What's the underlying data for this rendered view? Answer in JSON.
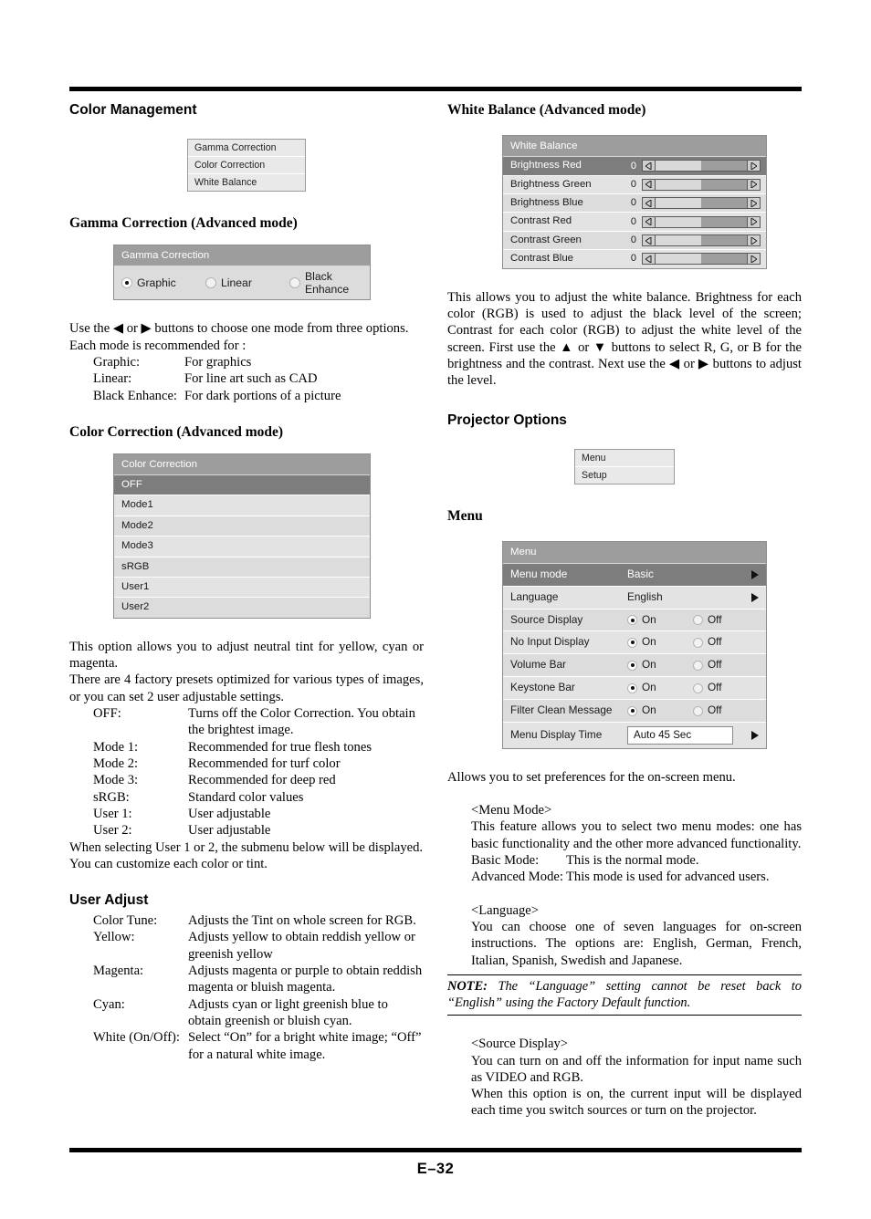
{
  "footer": {
    "page_label": "E–32"
  },
  "left": {
    "heading_color_management": "Color Management",
    "color_management_menu": [
      "Gamma Correction",
      "Color Correction",
      "White Balance"
    ],
    "heading_gamma": "Gamma Correction (Advanced mode)",
    "gamma_panel": {
      "title": "Gamma Correction",
      "options": [
        {
          "label": "Graphic",
          "selected": true
        },
        {
          "label": "Linear",
          "selected": false
        },
        {
          "label": "Black Enhance",
          "selected": false
        }
      ]
    },
    "gamma_text": {
      "line1": "Use the ◀ or ▶ buttons to choose one mode from three options.",
      "line2": "Each mode is recommended for :",
      "items": [
        {
          "term": "Graphic:",
          "desc": "For graphics"
        },
        {
          "term": "Linear:",
          "desc": "For line art such as CAD"
        },
        {
          "term": "Black Enhance:",
          "desc": "For dark portions of a picture"
        }
      ]
    },
    "heading_color_correction": "Color Correction (Advanced mode)",
    "color_correction_panel": {
      "title": "Color Correction",
      "rows": [
        {
          "label": "OFF",
          "selected": true
        },
        {
          "label": "Mode1",
          "selected": false
        },
        {
          "label": "Mode2",
          "selected": false
        },
        {
          "label": "Mode3",
          "selected": false
        },
        {
          "label": "sRGB",
          "selected": false
        },
        {
          "label": "User1",
          "selected": false
        },
        {
          "label": "User2",
          "selected": false
        }
      ]
    },
    "color_correction_text": {
      "para1": "This option allows you to adjust neutral tint for yellow, cyan or magenta.",
      "para2": "There are 4 factory presets optimized for various types of images, or you can set 2 user adjustable settings.",
      "items": [
        {
          "term": "OFF:",
          "desc": "Turns off the Color Correction. You obtain the brightest image."
        },
        {
          "term": "Mode 1:",
          "desc": "Recommended for true flesh tones"
        },
        {
          "term": "Mode 2:",
          "desc": "Recommended for turf color"
        },
        {
          "term": "Mode 3:",
          "desc": "Recommended for deep red"
        },
        {
          "term": "sRGB:",
          "desc": "Standard color values"
        },
        {
          "term": "User 1:",
          "desc": "User adjustable"
        },
        {
          "term": "User 2:",
          "desc": "User adjustable"
        }
      ],
      "para3": "When selecting User 1 or 2, the submenu below will be displayed. You can customize each color or tint."
    },
    "heading_user_adjust": "User Adjust",
    "user_adjust_items": [
      {
        "term": "Color Tune:",
        "desc": "Adjusts the Tint on whole screen for RGB."
      },
      {
        "term": "Yellow:",
        "desc": "Adjusts yellow to obtain reddish yellow or greenish yellow"
      },
      {
        "term": "Magenta:",
        "desc": "Adjusts magenta or purple to obtain reddish magenta or bluish magenta."
      },
      {
        "term": "Cyan:",
        "desc": "Adjusts cyan or light greenish blue to obtain greenish or bluish cyan."
      },
      {
        "term": "White (On/Off):",
        "desc": "Select “On” for a bright white image; “Off” for a natural white image."
      }
    ]
  },
  "right": {
    "heading_white_balance": "White Balance (Advanced mode)",
    "white_balance_panel": {
      "title": "White Balance",
      "rows": [
        {
          "label": "Brightness Red",
          "value": "0",
          "selected": true
        },
        {
          "label": "Brightness Green",
          "value": "0",
          "selected": false
        },
        {
          "label": "Brightness Blue",
          "value": "0",
          "selected": false
        },
        {
          "label": "Contrast Red",
          "value": "0",
          "selected": false
        },
        {
          "label": "Contrast Green",
          "value": "0",
          "selected": false
        },
        {
          "label": "Contrast Blue",
          "value": "0",
          "selected": false
        }
      ]
    },
    "white_balance_text": "This allows you to adjust the white balance. Brightness for each color (RGB) is used to adjust the black level of the screen; Contrast for each color (RGB) to adjust the white level of the screen. First use the ▲ or ▼ buttons to select R, G, or B for the brightness and the contrast. Next use the ◀ or ▶ buttons to adjust the level.",
    "heading_projector_options": "Projector Options",
    "projector_options_menu": [
      "Menu",
      "Setup"
    ],
    "heading_menu": "Menu",
    "menu_panel": {
      "title": "Menu",
      "rows": [
        {
          "label": "Menu mode",
          "type": "value-arrow",
          "value": "Basic",
          "selected": true
        },
        {
          "label": "Language",
          "type": "value-arrow",
          "value": "English",
          "selected": false
        },
        {
          "label": "Source Display",
          "type": "onoff",
          "on_label": "On",
          "off_label": "Off",
          "state": "On",
          "selected": false
        },
        {
          "label": "No Input Display",
          "type": "onoff",
          "on_label": "On",
          "off_label": "Off",
          "state": "On",
          "selected": false
        },
        {
          "label": "Volume Bar",
          "type": "onoff",
          "on_label": "On",
          "off_label": "Off",
          "state": "On",
          "selected": false
        },
        {
          "label": "Keystone Bar",
          "type": "onoff",
          "on_label": "On",
          "off_label": "Off",
          "state": "On",
          "selected": false
        },
        {
          "label": "Filter Clean Message",
          "type": "onoff",
          "on_label": "On",
          "off_label": "Off",
          "state": "On",
          "selected": false
        },
        {
          "label": "Menu Display Time",
          "type": "input-arrow",
          "value": "Auto 45 Sec",
          "selected": false
        }
      ]
    },
    "menu_intro": "Allows you to set preferences for the on-screen menu.",
    "menu_mode_heading": "<Menu Mode>",
    "menu_mode_text": "This feature allows you to select two menu modes: one has basic functionality and the other more advanced functionality.",
    "menu_mode_items": [
      {
        "term": "Basic Mode:",
        "desc": "This is the normal mode."
      },
      {
        "term": "Advanced Mode:",
        "desc": "This mode is used for advanced users."
      }
    ],
    "language_heading": "<Language>",
    "language_text": "You can choose one of seven languages for on-screen instructions. The options are: English, German, French, Italian, Spanish, Swedish and Japanese.",
    "note_prefix": "NOTE:",
    "note_text": " The “Language” setting cannot be reset back to “English” using the Factory Default function.",
    "source_display_heading": "<Source Display>",
    "source_display_text1": "You can turn on and off the information for input name such as VIDEO and RGB.",
    "source_display_text2": "When this option is on, the current input will be displayed each time you switch sources or turn on the projector."
  }
}
